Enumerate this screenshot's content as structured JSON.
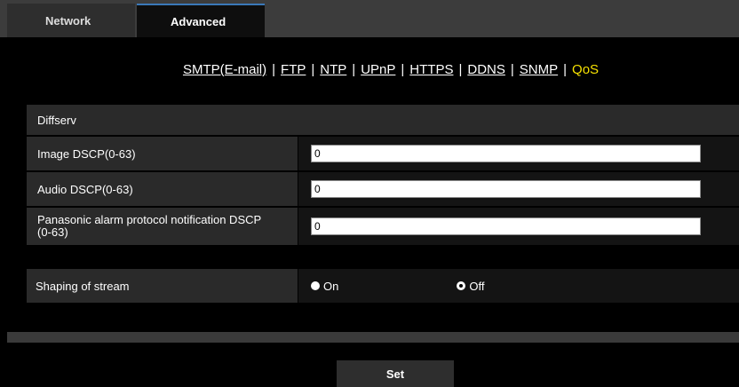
{
  "tabs": [
    {
      "label": "Network"
    },
    {
      "label": "Advanced"
    }
  ],
  "links": {
    "items": [
      "SMTP(E-mail)",
      "FTP",
      "NTP",
      "UPnP",
      "HTTPS",
      "DDNS",
      "SNMP"
    ],
    "current": "QoS",
    "separator": "|"
  },
  "diffserv": {
    "title": "Diffserv",
    "image_dscp": {
      "label": "Image DSCP(0-63)",
      "value": "0"
    },
    "audio_dscp": {
      "label": "Audio DSCP(0-63)",
      "value": "0"
    },
    "alarm_dscp": {
      "label_line1": "Panasonic alarm protocol notification DSCP",
      "label_line2": "(0-63)",
      "value": "0"
    }
  },
  "shaping": {
    "label": "Shaping of stream",
    "on_label": "On",
    "off_label": "Off",
    "selected": "Off"
  },
  "set_label": "Set"
}
